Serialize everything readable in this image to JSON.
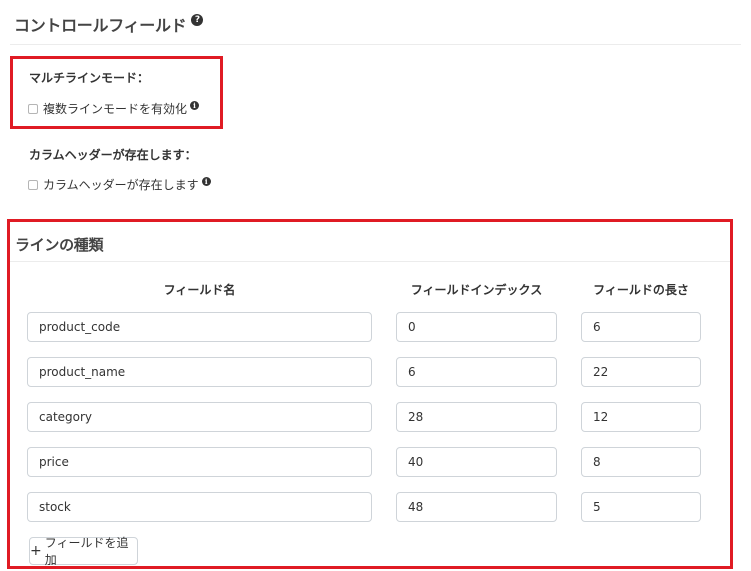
{
  "header": {
    "title": "コントロールフィールド",
    "help_glyph": "?"
  },
  "multiline": {
    "label": "マルチラインモード：",
    "checkbox_label": "複数ラインモードを有効化",
    "checked": false,
    "info_glyph": "i"
  },
  "column_header": {
    "label": "カラムヘッダーが存在します：",
    "checkbox_label": "カラムヘッダーが存在します",
    "checked": false,
    "info_glyph": "i"
  },
  "line_types": {
    "title": "ラインの種類",
    "columns": {
      "field_name": "フィールド名",
      "field_index": "フィールドインデックス",
      "field_length": "フィールドの長さ"
    },
    "rows": [
      {
        "name": "product_code",
        "index": "0",
        "length": "6"
      },
      {
        "name": "product_name",
        "index": "6",
        "length": "22"
      },
      {
        "name": "category",
        "index": "28",
        "length": "12"
      },
      {
        "name": "price",
        "index": "40",
        "length": "8"
      },
      {
        "name": "stock",
        "index": "48",
        "length": "5"
      }
    ],
    "add_button_label": "フィールドを追加",
    "add_button_glyph": "+"
  },
  "colors": {
    "highlight": "#e01b24",
    "input_border": "#cfd4d9"
  }
}
